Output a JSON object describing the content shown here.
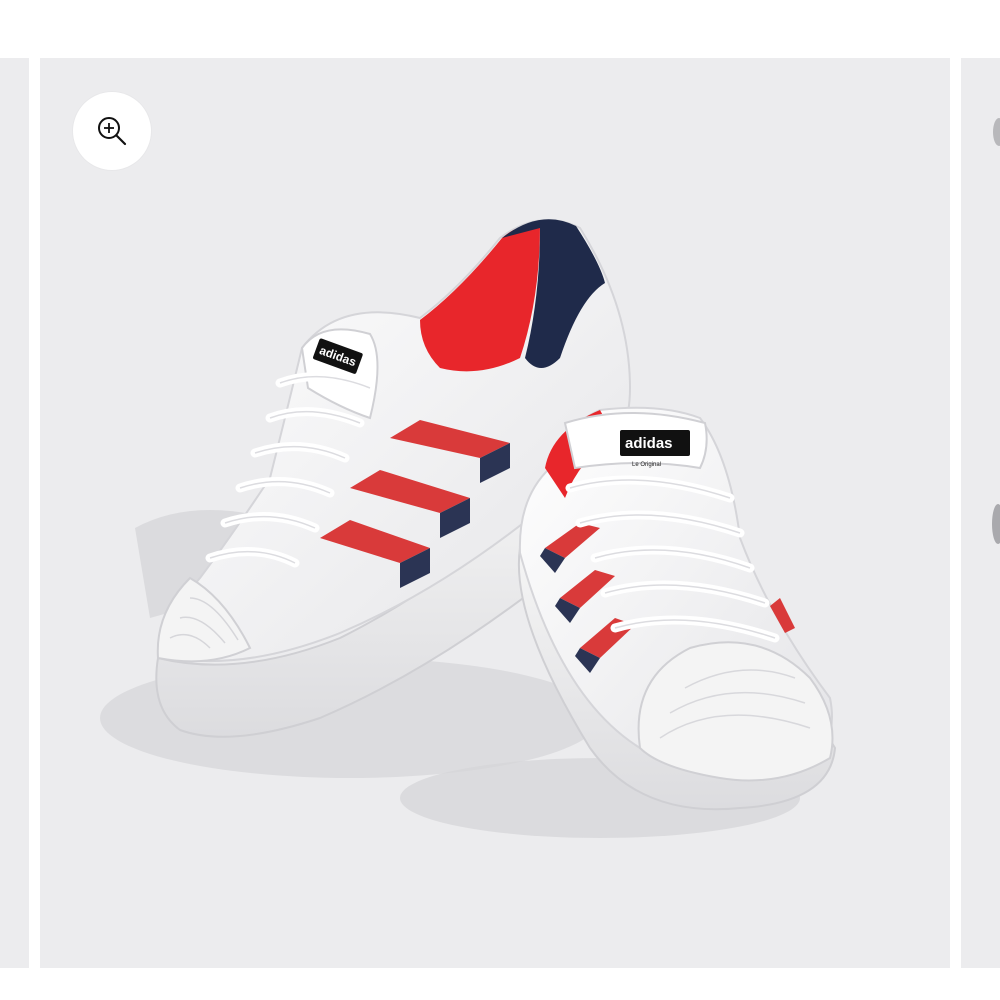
{
  "gallery": {
    "background_color": "#ececee",
    "zoom_icon": "zoom-in-icon",
    "product": {
      "upper_color": "#ffffff",
      "stripe_red": "#d93a3a",
      "stripe_navy": "#2b3454",
      "lining_red": "#e8262b",
      "heel_navy": "#1f2a4a",
      "tongue_label_brand": "adidas",
      "tongue_label_sub": "Le Original"
    }
  }
}
